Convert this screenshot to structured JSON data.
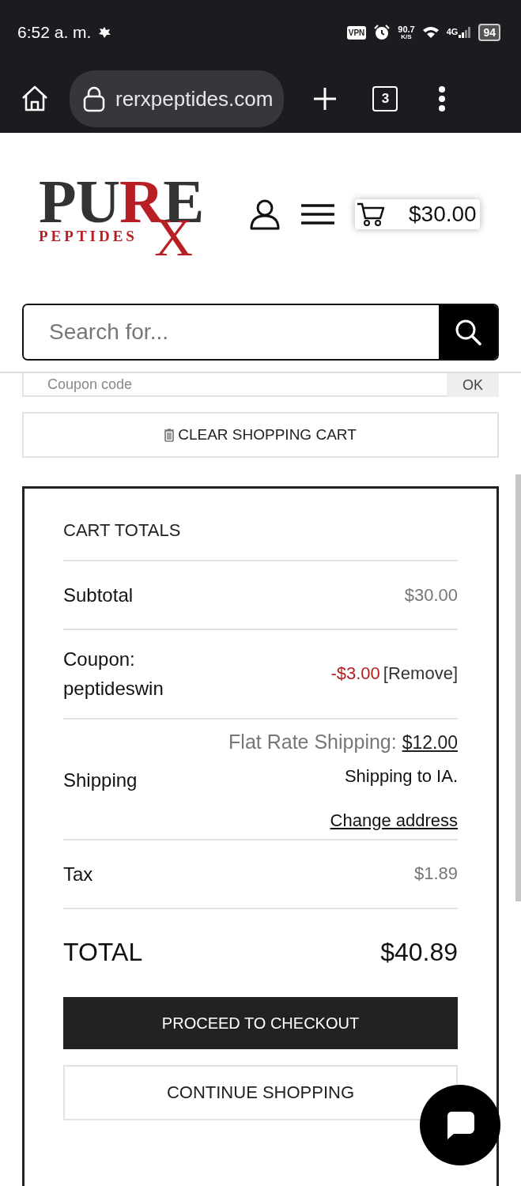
{
  "status_bar": {
    "time": "6:52 a. m.",
    "vpn": "VPN",
    "speed": "90.7",
    "speed_unit": "K/S",
    "network": "4G",
    "battery": "94"
  },
  "browser": {
    "url": "rerxpeptides.com",
    "tab_count": "3"
  },
  "header": {
    "logo": {
      "title_parts": [
        {
          "text": "PU",
          "color": "#333333"
        },
        {
          "text": "R",
          "color": "#b81f24"
        },
        {
          "text": "E",
          "color": "#333333"
        }
      ],
      "subtitle": "PEPTIDES",
      "mark": "X"
    },
    "cart_total": "$30.00"
  },
  "search": {
    "placeholder": "Search for..."
  },
  "coupon": {
    "placeholder": "Coupon code",
    "button": "OK"
  },
  "clear_cart": "CLEAR SHOPPING CART",
  "cart_totals": {
    "title": "CART TOTALS",
    "rows": [
      {
        "kind": "amount",
        "label": "Subtotal",
        "value": "$30.00"
      },
      {
        "kind": "coupon",
        "label": "Coupon: peptideswin",
        "value": "-$3.00",
        "link": "[Remove]"
      },
      {
        "kind": "shipping",
        "label": "Shipping",
        "method": "Flat Rate Shipping:",
        "price": "$12.00",
        "destination": "Shipping to IA.",
        "link": "Change address"
      },
      {
        "kind": "amount",
        "label": "Tax",
        "value": "$1.89"
      },
      {
        "kind": "total",
        "label": "TOTAL",
        "value": "$40.89"
      }
    ],
    "checkout": "PROCEED TO CHECKOUT",
    "continue": "CONTINUE SHOPPING"
  }
}
